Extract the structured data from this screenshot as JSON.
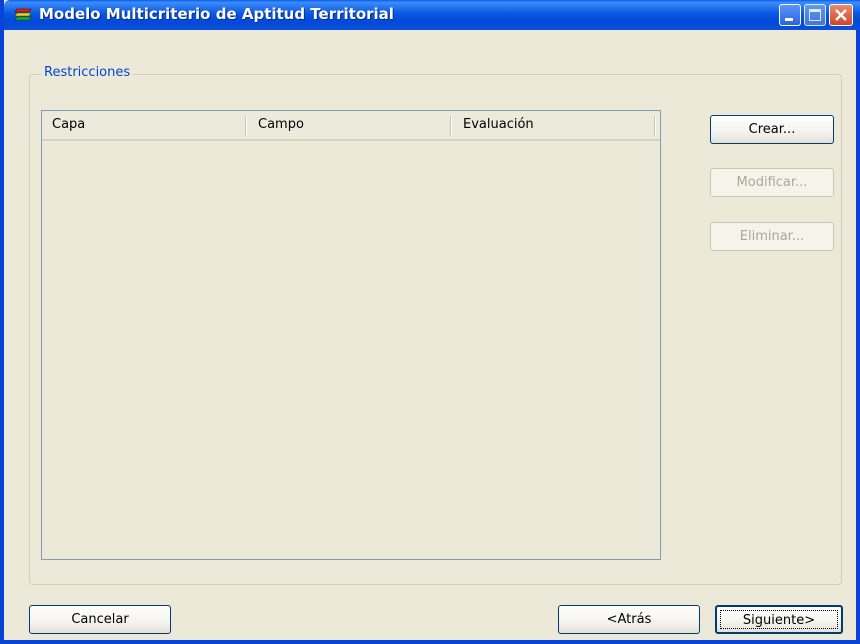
{
  "window": {
    "title": "Modelo Multicriterio de Aptitud Territorial",
    "controls": [
      "minimize-icon",
      "maximize-icon",
      "close-icon"
    ]
  },
  "group": {
    "legend": "Restricciones"
  },
  "table": {
    "columns": [
      "Capa",
      "Campo",
      "Evaluación"
    ],
    "rows": []
  },
  "side_buttons": {
    "create": "Crear...",
    "modify": "Modificar...",
    "delete": "Eliminar..."
  },
  "footer": {
    "cancel": "Cancelar",
    "back": "<Atrás",
    "next": "Siguiente>"
  },
  "colors": {
    "titlebar": "#0857E3",
    "legend": "#0046D5",
    "window_bg": "#ECE9D8"
  }
}
